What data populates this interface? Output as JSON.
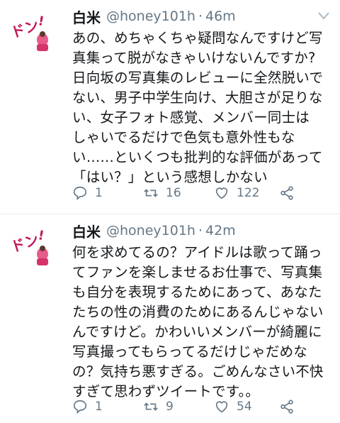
{
  "tweets": [
    {
      "name": "白米",
      "handle": "@honey101h",
      "separator": "·",
      "time": "46m",
      "text": "あの、めちゃくちゃ疑問なんですけど写\n真集って脱がなきゃいけないんですか?\n日向坂の写真集のレビューに全然脱いで\nない、男子中学生向け、大胆さが足りな\nい、女子フォト感覚、メンバー同士は\nしゃいでるだけで色気も意外性もな\nい……といくつも批判的な評価があって\n「はい？」という感想しかない",
      "replies": "1",
      "retweets": "16",
      "likes": "122"
    },
    {
      "name": "白米",
      "handle": "@honey101h",
      "separator": "·",
      "time": "42m",
      "text": "何を求めてるの？アイドルは歌って踊っ\nてファンを楽しませるお仕事で、写真集\nも自分を表現するためにあって、あなた\nたちの性の消費のためにあるんじゃない\nんですけど。かわいいメンバーが綺麗に\n写真撮ってもらってるだけじゃだめな\nの？気持ち悪すぎる。ごめんなさい不快\nすぎて思わずツイートです。。",
      "replies": "1",
      "retweets": "9",
      "likes": "54"
    }
  ],
  "avatar_logo_text": "ドン!",
  "colors": {
    "text": "#14171a",
    "muted": "#657786",
    "divider": "#e6ecf0",
    "avatar_accent": "#d6336c"
  },
  "icons": [
    "caret-down-icon",
    "reply-icon",
    "retweet-icon",
    "heart-icon",
    "share-icon"
  ]
}
